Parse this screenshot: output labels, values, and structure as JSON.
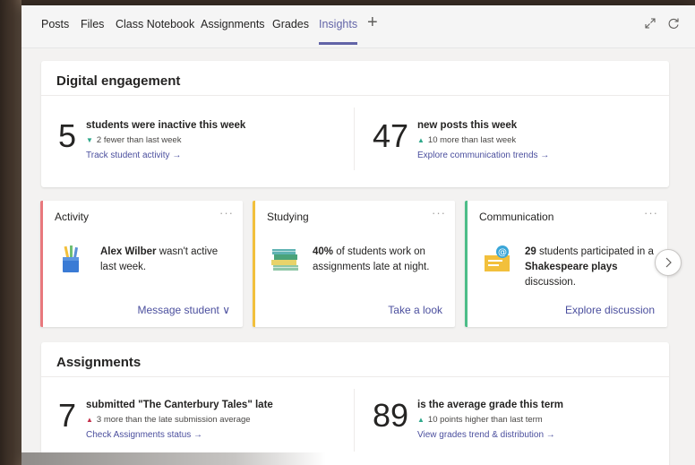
{
  "tabs": [
    {
      "label": "Posts",
      "active": false
    },
    {
      "label": "Files",
      "active": false
    },
    {
      "label": "Class Notebook",
      "active": false
    },
    {
      "label": "Assignments",
      "active": false
    },
    {
      "label": "Grades",
      "active": false
    },
    {
      "label": "Insights",
      "active": true
    }
  ],
  "add_tab_glyph": "+",
  "digital_engagement": {
    "title": "Digital engagement",
    "left": {
      "number": "5",
      "headline": "students were inactive this week",
      "delta_icon": "down-triangle-icon",
      "delta": "2 fewer than last week",
      "link": "Track student activity →"
    },
    "right": {
      "number": "47",
      "headline": "new posts this week",
      "delta_icon": "up-triangle-icon",
      "delta": "10 more than last week",
      "link": "Explore communication trends →"
    }
  },
  "insight_cards": [
    {
      "title": "Activity",
      "menu": "···",
      "accent": "#e8787d",
      "illustration": "pencil-cup-icon",
      "bold": "Alex Wilber",
      "text": " wasn't active last week.",
      "action": "Message student ∨"
    },
    {
      "title": "Studying",
      "menu": "···",
      "accent": "#f2c03c",
      "illustration": "books-stack-icon",
      "bold": "40%",
      "text": " of students work on assignments late at night.",
      "action": "Take a look"
    },
    {
      "title": "Communication",
      "menu": "···",
      "accent": "#4dbd88",
      "illustration": "email-at-icon",
      "bold": "29",
      "text": " students participated in a ",
      "bold2": "Shakespeare plays",
      "text2": " discussion.",
      "action": "Explore discussion"
    }
  ],
  "assignments": {
    "title": "Assignments",
    "left": {
      "number": "7",
      "headline": "submitted \"The Canterbury Tales\" late",
      "delta_icon": "up-triangle-icon",
      "delta": "3 more than the late submission average",
      "link": "Check Assignments status →"
    },
    "right": {
      "number": "89",
      "headline": "is the average grade this term",
      "delta_icon": "up-triangle-icon",
      "delta": "10 points higher than last term",
      "link": "View grades trend & distribution →"
    }
  },
  "colors": {
    "accent": "#6264a7",
    "link": "#4b4f9e",
    "positive": "#2ea88a",
    "negative": "#c4314b"
  }
}
